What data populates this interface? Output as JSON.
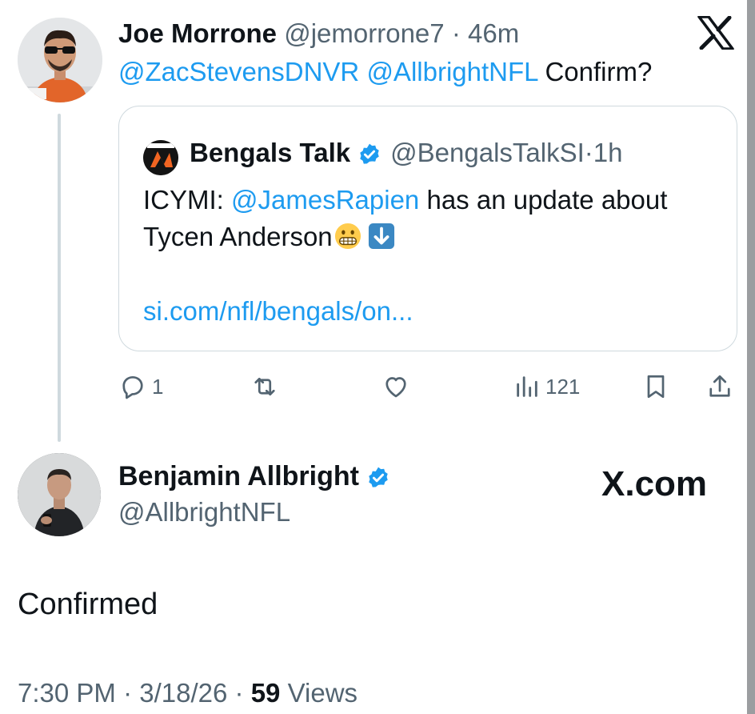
{
  "brand": {
    "logo": "x-logo-icon",
    "wordmark": "X.com"
  },
  "colors": {
    "link": "#1d9bf0",
    "muted": "#536471",
    "text": "#0f1419",
    "border": "#cfd9de",
    "verified": "#1d9bf0"
  },
  "reply_tweet": {
    "author_name": "Joe Morrone",
    "author_handle": "@jemorrone7",
    "separator": "·",
    "time": "46m",
    "mentions": [
      "@ZacStevensDNVR",
      "@AllbrightNFL"
    ],
    "text": "Confirm?",
    "quoted_tweet": {
      "author_name": "Bengals Talk",
      "verified": true,
      "author_handle": "@BengalsTalkSI",
      "separator": "·",
      "time": "1h",
      "text_prefix": "ICYMI:",
      "mention": "@JamesRapien",
      "text_middle": "has an update about",
      "text_line2": "Tycen Anderson",
      "emojis": [
        "grimacing-face-emoji",
        "down-arrow-emoji"
      ],
      "link": "si.com/nfl/bengals/on..."
    },
    "actions": {
      "reply_count": "1",
      "retweet_count": "",
      "like_count": "",
      "views_count": "121"
    }
  },
  "main_tweet": {
    "author_name": "Benjamin Allbright",
    "verified": true,
    "author_handle": "@AllbrightNFL",
    "text": "Confirmed",
    "time": "7:30 PM",
    "separator": "·",
    "date": "3/18/26",
    "views_count": "59",
    "views_label": "Views"
  }
}
